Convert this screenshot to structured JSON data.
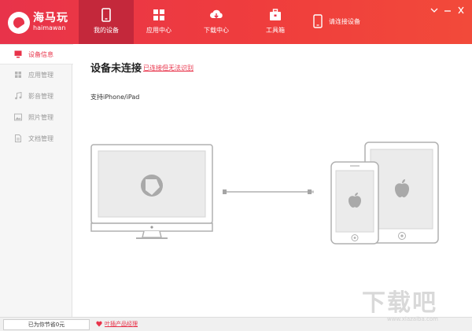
{
  "app": {
    "logo_name": "海马玩",
    "logo_en": "haimawan"
  },
  "nav": {
    "tabs": [
      {
        "label": "我的设备",
        "icon": "phone-icon",
        "active": true
      },
      {
        "label": "应用中心",
        "icon": "grid-icon",
        "active": false
      },
      {
        "label": "下载中心",
        "icon": "cloud-download-icon",
        "active": false
      },
      {
        "label": "工具箱",
        "icon": "toolbox-icon",
        "active": false
      }
    ],
    "connect_label": "请连接设备"
  },
  "sidebar": {
    "items": [
      {
        "label": "设备信息",
        "icon": "monitor-icon",
        "active": true
      },
      {
        "label": "应用管理",
        "icon": "grid-icon",
        "active": false
      },
      {
        "label": "影音管理",
        "icon": "music-note-icon",
        "active": false
      },
      {
        "label": "照片管理",
        "icon": "image-icon",
        "active": false
      },
      {
        "label": "文档管理",
        "icon": "document-icon",
        "active": false
      }
    ]
  },
  "main": {
    "title": "设备未连接",
    "title_link": "已连接但无法识别",
    "support_text": "支持iPhone/iPad"
  },
  "status": {
    "savings": "已为你节省0元",
    "contact": "叶插产品经理"
  },
  "watermark": {
    "big": "下载吧",
    "small": "www.xiazaiba.com"
  },
  "colors": {
    "brand": "#e8334a",
    "brand_dark": "#c4283b",
    "sidebar_bg": "#f6f6f6"
  }
}
